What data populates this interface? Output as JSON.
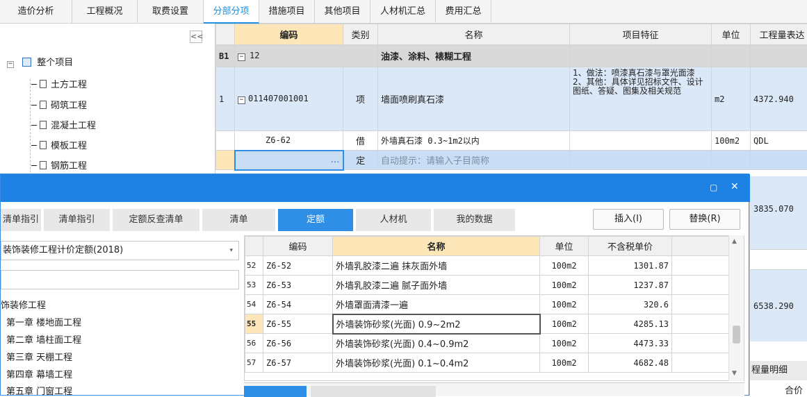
{
  "top_tabs": [
    "造价分析",
    "工程概况",
    "取费设置",
    "分部分项",
    "措施项目",
    "其他项目",
    "人材机汇总",
    "费用汇总"
  ],
  "active_top_tab": 3,
  "tree": {
    "collapse_glyph": "<<",
    "root": "整个项目",
    "items": [
      "土方工程",
      "砌筑工程",
      "混凝土工程",
      "模板工程",
      "钢筋工程"
    ]
  },
  "grid": {
    "headers": [
      "编码",
      "类别",
      "名称",
      "项目特征",
      "单位",
      "工程量表达"
    ],
    "rows": [
      {
        "idx": "B1",
        "code": "12",
        "type": "",
        "name": "油漆、涂料、裱糊工程",
        "feature": "",
        "unit": "",
        "qty": ""
      },
      {
        "idx": "1",
        "code": "011407001001",
        "type": "项",
        "name": "墙面喷刷真石漆",
        "feature": "1、做法：喷漆真石漆与罩光面漆\n2、其他：具体详见招标文件、设计图纸、答疑、图集及相关规范",
        "unit": "m2",
        "qty": "4372.940"
      },
      {
        "idx": "",
        "code": "Z6-62",
        "type": "借",
        "name": "外墙真石漆 0.3~1m2以内",
        "feature": "",
        "unit": "100m2",
        "qty": "QDL"
      },
      {
        "idx": "",
        "code": "…",
        "type": "定",
        "name": "自动提示：请输入子目简称",
        "feature": "",
        "unit": "",
        "qty": ""
      }
    ],
    "right_values": [
      "3835.070",
      "6538.290"
    ],
    "right_label": "程量明细",
    "right_label2": "合价"
  },
  "dialog": {
    "tabs": [
      "清单指引",
      "清单指引",
      "定额反查清单",
      "清单",
      "定额",
      "人材机",
      "我的数据"
    ],
    "active_tab": 4,
    "insert_label": "插入(I)",
    "replace_label": "替换(R)",
    "dropdown_value": "装饰装修工程计价定额(2018)",
    "tree_root": "饰装修工程",
    "chapters": [
      "第一章 楼地面工程",
      "第二章 墙柱面工程",
      "第三章 天棚工程",
      "第四章 幕墙工程",
      "第五章 门窗工程"
    ],
    "list_headers": [
      "编码",
      "名称",
      "单位",
      "不含税单价"
    ],
    "list_rows": [
      {
        "n": "52",
        "code": "Z6-52",
        "name": "外墙乳胶漆二遍 抹灰面外墙",
        "unit": "100m2",
        "price": "1301.87"
      },
      {
        "n": "53",
        "code": "Z6-53",
        "name": "外墙乳胶漆二遍 腻子面外墙",
        "unit": "100m2",
        "price": "1237.87"
      },
      {
        "n": "54",
        "code": "Z6-54",
        "name": "外墙罩面清漆一遍",
        "unit": "100m2",
        "price": "320.6"
      },
      {
        "n": "55",
        "code": "Z6-55",
        "name": "外墙装饰砂浆(光面) 0.9~2m2",
        "unit": "100m2",
        "price": "4285.13"
      },
      {
        "n": "56",
        "code": "Z6-56",
        "name": "外墙装饰砂浆(光面) 0.4~0.9m2",
        "unit": "100m2",
        "price": "4473.33"
      },
      {
        "n": "57",
        "code": "Z6-57",
        "name": "外墙装饰砂浆(光面) 0.1~0.4m2",
        "unit": "100m2",
        "price": "4682.48"
      }
    ],
    "selected_row": 3
  }
}
